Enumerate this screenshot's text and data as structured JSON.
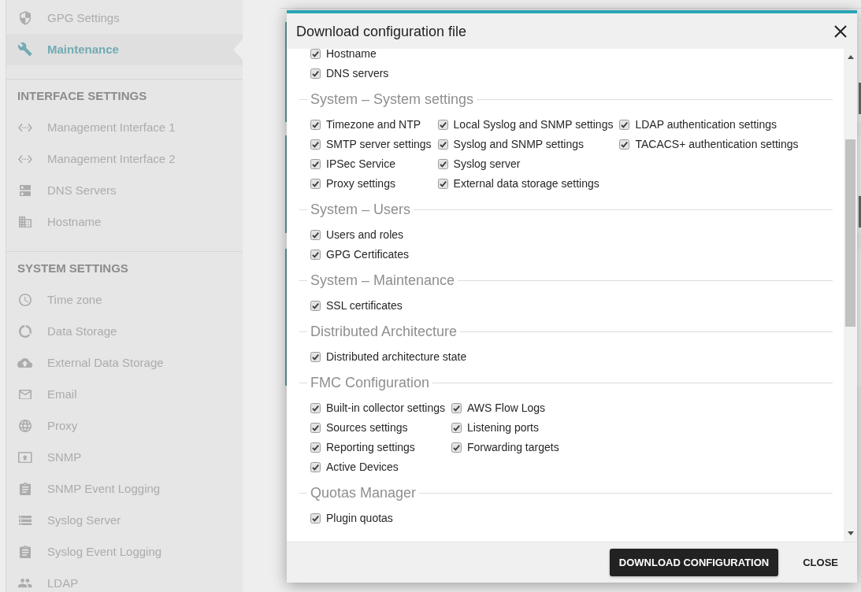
{
  "sidebar": {
    "groups": [
      {
        "items": [
          {
            "label": "GPG Settings",
            "selected": false
          },
          {
            "label": "Maintenance",
            "selected": true
          }
        ]
      },
      {
        "title": "INTERFACE SETTINGS",
        "items": [
          {
            "label": "Management Interface 1",
            "selected": false
          },
          {
            "label": "Management Interface 2",
            "selected": false
          },
          {
            "label": "DNS Servers",
            "selected": false
          },
          {
            "label": "Hostname",
            "selected": false
          }
        ]
      },
      {
        "title": "SYSTEM SETTINGS",
        "items": [
          {
            "label": "Time zone",
            "selected": false
          },
          {
            "label": "Data Storage",
            "selected": false
          },
          {
            "label": "External Data Storage",
            "selected": false
          },
          {
            "label": "Email",
            "selected": false
          },
          {
            "label": "Proxy",
            "selected": false
          },
          {
            "label": "SNMP",
            "selected": false
          },
          {
            "label": "SNMP Event Logging",
            "selected": false
          },
          {
            "label": "Syslog Server",
            "selected": false
          },
          {
            "label": "Syslog Event Logging",
            "selected": false
          },
          {
            "label": "LDAP",
            "selected": false
          }
        ]
      }
    ]
  },
  "dialog": {
    "title": "Download configuration file",
    "sections": [
      {
        "columns": [
          [
            {
              "label": "Hostname",
              "checked": true
            },
            {
              "label": "DNS servers",
              "checked": true
            }
          ]
        ]
      },
      {
        "title": "System – System settings",
        "columns": [
          [
            {
              "label": "Timezone and NTP",
              "checked": true
            },
            {
              "label": "SMTP server settings",
              "checked": true
            },
            {
              "label": "IPSec Service",
              "checked": true
            },
            {
              "label": "Proxy settings",
              "checked": true
            }
          ],
          [
            {
              "label": "Local Syslog and SNMP settings",
              "checked": true
            },
            {
              "label": "Syslog and SNMP settings",
              "checked": true
            },
            {
              "label": "Syslog server",
              "checked": true
            },
            {
              "label": "External data storage settings",
              "checked": true
            }
          ],
          [
            {
              "label": "LDAP authentication settings",
              "checked": true
            },
            {
              "label": "TACACS+ authentication settings",
              "checked": true
            }
          ]
        ]
      },
      {
        "title": "System – Users",
        "columns": [
          [
            {
              "label": "Users and roles",
              "checked": true
            },
            {
              "label": "GPG Certificates",
              "checked": true
            }
          ]
        ]
      },
      {
        "title": "System – Maintenance",
        "columns": [
          [
            {
              "label": "SSL certificates",
              "checked": true
            }
          ]
        ]
      },
      {
        "title": "Distributed Architecture",
        "columns": [
          [
            {
              "label": "Distributed architecture state",
              "checked": true
            }
          ]
        ]
      },
      {
        "title": "FMC Configuration",
        "columns": [
          [
            {
              "label": "Built-in collector settings",
              "checked": true
            },
            {
              "label": "Sources settings",
              "checked": true
            },
            {
              "label": "Reporting settings",
              "checked": true
            },
            {
              "label": "Active Devices",
              "checked": true
            }
          ],
          [
            {
              "label": "AWS Flow Logs",
              "checked": true
            },
            {
              "label": "Listening ports",
              "checked": true
            },
            {
              "label": "Forwarding targets",
              "checked": true
            }
          ]
        ]
      },
      {
        "title": "Quotas Manager",
        "columns": [
          [
            {
              "label": "Plugin quotas",
              "checked": true
            }
          ]
        ]
      }
    ],
    "buttons": [
      {
        "label": "DOWNLOAD CONFIGURATION",
        "kind": "primary"
      },
      {
        "label": "CLOSE",
        "kind": "flat"
      }
    ]
  }
}
